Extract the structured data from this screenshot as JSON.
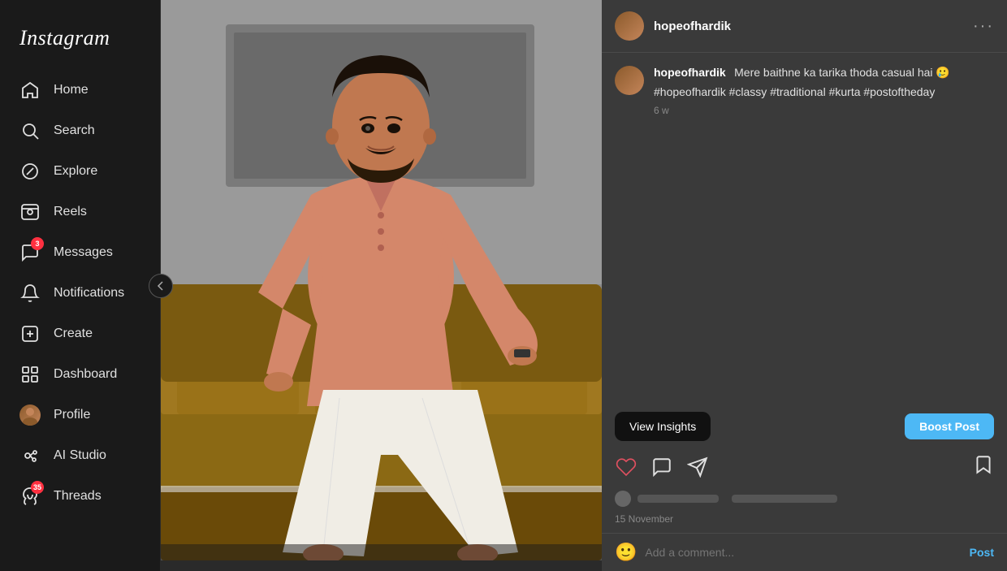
{
  "sidebar": {
    "logo": "Instagram",
    "nav_items": [
      {
        "id": "home",
        "label": "Home",
        "icon": "home-icon",
        "badge": null
      },
      {
        "id": "search",
        "label": "Search",
        "icon": "search-icon",
        "badge": null
      },
      {
        "id": "explore",
        "label": "Explore",
        "icon": "explore-icon",
        "badge": null
      },
      {
        "id": "reels",
        "label": "Reels",
        "icon": "reels-icon",
        "badge": null
      },
      {
        "id": "messages",
        "label": "Messages",
        "icon": "messages-icon",
        "badge": "3"
      },
      {
        "id": "notifications",
        "label": "Notifications",
        "icon": "notifications-icon",
        "badge": null
      },
      {
        "id": "create",
        "label": "Create",
        "icon": "create-icon",
        "badge": null
      },
      {
        "id": "dashboard",
        "label": "Dashboard",
        "icon": "dashboard-icon",
        "badge": null
      },
      {
        "id": "profile",
        "label": "Profile",
        "icon": "profile-icon",
        "badge": null
      },
      {
        "id": "ai-studio",
        "label": "AI Studio",
        "icon": "ai-studio-icon",
        "badge": null
      },
      {
        "id": "threads",
        "label": "Threads",
        "icon": "threads-icon",
        "badge": "35"
      }
    ]
  },
  "post": {
    "username_header": "hopeofhardik",
    "username_caption": "hopeofhardik",
    "caption_text": "Mere baithne ka tarika thoda casual hai 🥲",
    "caption_break": ".",
    "hashtags": "#hopeofhardik #classy #traditional #kurta #postoftheday",
    "time_ago": "6 w",
    "date": "15 November",
    "view_insights_label": "View Insights",
    "boost_post_label": "Boost Post",
    "add_comment_placeholder": "Add a comment...",
    "post_button_label": "Post"
  }
}
